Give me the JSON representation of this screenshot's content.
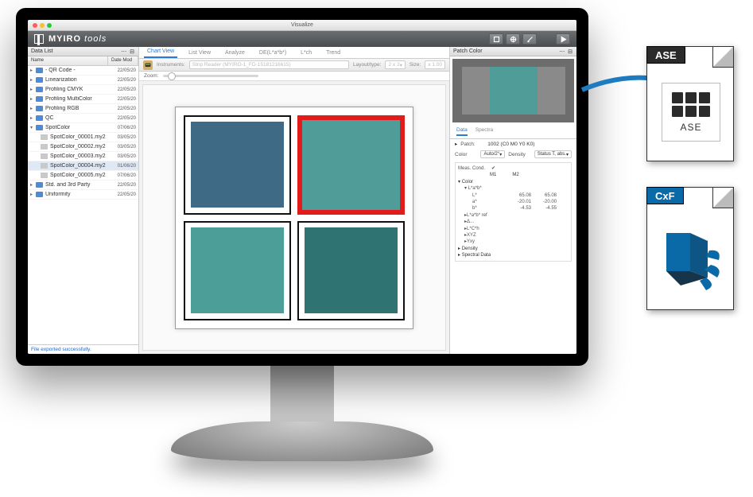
{
  "window": {
    "title": "Visualize"
  },
  "brand": {
    "name": "MYIRO",
    "suffix": "tools"
  },
  "sidebar": {
    "title": "Data List",
    "columns": [
      "Name",
      "Date Mod"
    ],
    "items": [
      {
        "name": "- QR Code -",
        "date": "22/05/20",
        "type": "folder"
      },
      {
        "name": "Linearization",
        "date": "22/05/20",
        "type": "folder"
      },
      {
        "name": "Profiling CMYK",
        "date": "22/05/20",
        "type": "folder"
      },
      {
        "name": "Profiling MultiColor",
        "date": "22/05/20",
        "type": "folder"
      },
      {
        "name": "Profiling RGB",
        "date": "22/05/20",
        "type": "folder"
      },
      {
        "name": "QC",
        "date": "22/05/20",
        "type": "folder"
      },
      {
        "name": "SpotColor",
        "date": "07/06/20",
        "type": "folder",
        "expanded": true,
        "children": [
          {
            "name": "SpotColor_00001.my2",
            "date": "03/05/20"
          },
          {
            "name": "SpotColor_00002.my2",
            "date": "03/05/20"
          },
          {
            "name": "SpotColor_00003.my2",
            "date": "03/05/20"
          },
          {
            "name": "SpotColor_00004.my2",
            "date": "01/06/20",
            "selected": true
          },
          {
            "name": "SpotColor_00005.my2",
            "date": "07/06/20"
          }
        ]
      },
      {
        "name": "Std. and 3rd Party",
        "date": "22/05/20",
        "type": "folder"
      },
      {
        "name": "Uniformity",
        "date": "22/05/20",
        "type": "folder"
      }
    ]
  },
  "status": "File exported successfully.",
  "center": {
    "tabs": [
      "Chart View",
      "List View",
      "Analyze",
      "DE(L*a*b*)",
      "L*ch",
      "Trend"
    ],
    "active_tab": 0,
    "toolbar": {
      "instruments_label": "Instruments:",
      "instruments_value": "Strip Reader (MYIRO-1_FD-15181216615)",
      "layout_label": "Layout/type:",
      "layout_value": "2 x 2",
      "size_label": "Size:",
      "size_value": "x 1.00"
    },
    "zoom_label": "Zoom:",
    "swatches": [
      {
        "id": "A",
        "color": "#3e6a86",
        "selected": false
      },
      {
        "id": "B",
        "color": "#4f9c98",
        "selected": true
      },
      {
        "id": "C",
        "color": "#4c9e98",
        "selected": false
      },
      {
        "id": "D",
        "color": "#2f7373",
        "selected": false
      }
    ]
  },
  "patch": {
    "title": "Patch Color",
    "tabs": [
      "Data",
      "Spectra"
    ],
    "active_tab": 0,
    "patch_label": "Patch:",
    "patch_value": "1002 (C0 M0 Y0 K0)",
    "color_label": "Color",
    "color_mode": "Auto/2°",
    "density_label": "Density",
    "density_mode": "Status T, abs.",
    "meas_cond_label": "Meas. Cond.",
    "color_header": "Color",
    "columns": [
      "M1",
      "M2"
    ],
    "rows": [
      {
        "key": "L*a*b*",
        "values": [
          "",
          ""
        ]
      },
      {
        "key": "L*",
        "values": [
          "65.08",
          "65.08"
        ]
      },
      {
        "key": "a*",
        "values": [
          "-20.01",
          "-20.00"
        ]
      },
      {
        "key": "b*",
        "values": [
          "-4.53",
          "-4.55"
        ]
      }
    ],
    "extra": [
      "L*a*b* ref",
      "Δ...",
      "L*C*h",
      "XYZ",
      "Yxy",
      "Density",
      "Spectral Data"
    ]
  },
  "export": {
    "ase_tab": "ASE",
    "ase_label": "ASE",
    "cxf_tab": "CxF"
  }
}
